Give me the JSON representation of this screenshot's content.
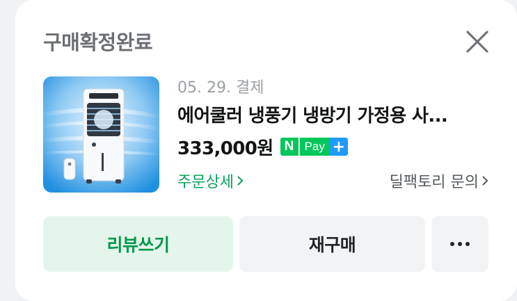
{
  "order_card": {
    "status_title": "구매확정완료",
    "close_icon": "close-icon",
    "product": {
      "image_desc": "product-thumbnail",
      "order_date": "05. 29. 결제",
      "name": "에어쿨러 냉풍기 냉방기 가정용 사...",
      "price": "333,000원",
      "payment_badge": {
        "n": "N",
        "pay": "Pay",
        "plus": "+"
      }
    },
    "links": {
      "order_detail": "주문상세",
      "seller_inquiry": "딜팩토리 문의"
    },
    "buttons": {
      "review": "리뷰쓰기",
      "reorder": "재구매",
      "more_icon": "more-horizontal-icon"
    },
    "colors": {
      "accent_green": "#03c75a",
      "link_green": "#0ca05a",
      "npay_plus_blue": "#1e9bff"
    }
  }
}
